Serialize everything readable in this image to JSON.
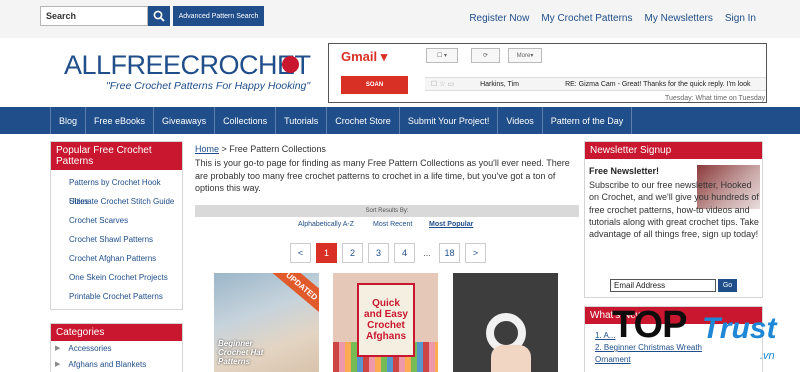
{
  "header": {
    "search_placeholder": "Search",
    "advanced_search": "Advanced Pattern Search",
    "links": [
      "Register Now",
      "My Crochet Patterns",
      "My Newsletters",
      "Sign In"
    ]
  },
  "logo": {
    "name": "ALLFREECROCHET",
    "tagline": "\"Free Crochet Patterns For Happy Hooking\""
  },
  "ad": {
    "app": "Gmail",
    "compose": "SOAN",
    "more": "More",
    "row1_sender": "Harkins, Tim",
    "row1_subject": "RE: Gizma Cam - Great! Thanks for the quick reply. I'm look",
    "row2_partial": "Tuesday: What time on Tuesday are we meeting?"
  },
  "nav": [
    "Blog",
    "Free eBooks",
    "Giveaways",
    "Collections",
    "Tutorials",
    "Crochet Store",
    "Submit Your Project!",
    "Videos",
    "Pattern of the Day"
  ],
  "sidebar": {
    "popular_title": "Popular Free Crochet Patterns",
    "popular_items": [
      "Patterns by Crochet Hook Sizes",
      "Ultimate Crochet Stitch Guide",
      "Crochet Scarves",
      "Crochet Shawl Patterns",
      "Crochet Afghan Patterns",
      "One Skein Crochet Projects",
      "Printable Crochet Patterns"
    ],
    "categories_title": "Categories",
    "categories": [
      "Accessories",
      "Afghans and Blankets"
    ]
  },
  "main": {
    "breadcrumb_home": "Home",
    "breadcrumb_current": "> Free Pattern Collections",
    "intro": "This is your go-to page for finding as many Free Pattern Collections as you'll ever need. There are probably too many free crochet patterns to crochet in a life time, but you've got a ton of options this way.",
    "sort_label": "Sort Results By:",
    "sort_options": [
      "Alphabetically A-Z",
      "Most Recent",
      "Most Popular"
    ],
    "pages": [
      "<",
      "1",
      "2",
      "3",
      "4",
      "...",
      "18",
      ">"
    ],
    "thumb1_badge": "UPDATED",
    "thumb1_caption": "Beginner Crochet Hat Patterns",
    "thumb2_sign": [
      "Quick",
      "and Easy",
      "Crochet",
      "Afghans"
    ]
  },
  "newsletter": {
    "title": "Newsletter Signup",
    "subtitle": "Free Newsletter!",
    "body": "Subscribe to our free newsletter, Hooked on Crochet, and we'll give you hundreds of free crochet patterns, how-to videos and tutorials along with great crochet tips. Take advantage of all things free, sign up today!",
    "email_placeholder": "Email Address",
    "go": "Go"
  },
  "whats_new": {
    "title": "What's New",
    "items": [
      "1. A...",
      "2. Beginner Christmas Wreath",
      "Ornament"
    ]
  },
  "watermark": {
    "top": "TOP",
    "trust": "Trust",
    "vn": ".vn"
  }
}
